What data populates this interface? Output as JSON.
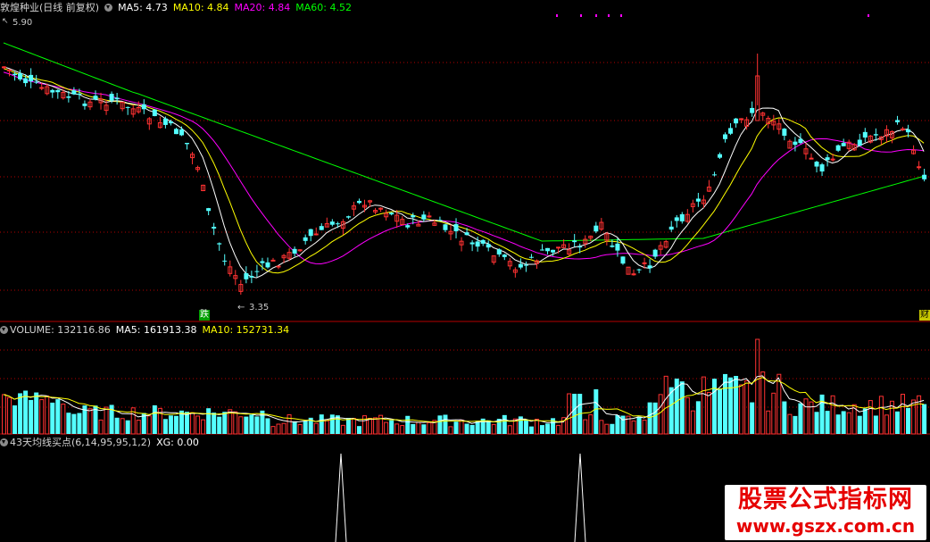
{
  "header": {
    "stock_name": "敦煌种业(日线 前复权)",
    "ma5": "MA5: 4.73",
    "ma10": "MA10: 4.84",
    "ma20": "MA20: 4.84",
    "ma60": "MA60: 4.52",
    "high_marker": "5.90",
    "low_marker": "3.35",
    "fall_badge": "跌",
    "finance_badge": "财"
  },
  "volume_panel": {
    "volume": "VOLUME: 132116.86",
    "ma5": "MA5: 161913.38",
    "ma10": "MA10: 152731.34"
  },
  "indicator_panel": {
    "name": "43天均线买点(6,14,95,95,1,2)",
    "xg": "XG: 0.00"
  },
  "watermark": {
    "title": "股票公式指标网",
    "url": "www.gszx.com.cn"
  },
  "colors": {
    "up": "#ff3232",
    "down": "#54ffff",
    "ma5": "#ffffff",
    "ma10": "#ffff00",
    "ma20": "#ff00ff",
    "ma60": "#00ff00",
    "separator": "#b40000",
    "grid": "#b40000"
  },
  "chart_data": {
    "type": "candlestick",
    "price_range": [
      3.35,
      5.9
    ],
    "ma_values": {
      "MA5": 4.73,
      "MA10": 4.84,
      "MA20": 4.84,
      "MA60": 4.52
    },
    "volume": {
      "last": 132116.86,
      "ma5": 161913.38,
      "ma10": 152731.34
    },
    "indicator_signals": "two buy-point spikes (XG) in lower panel"
  }
}
